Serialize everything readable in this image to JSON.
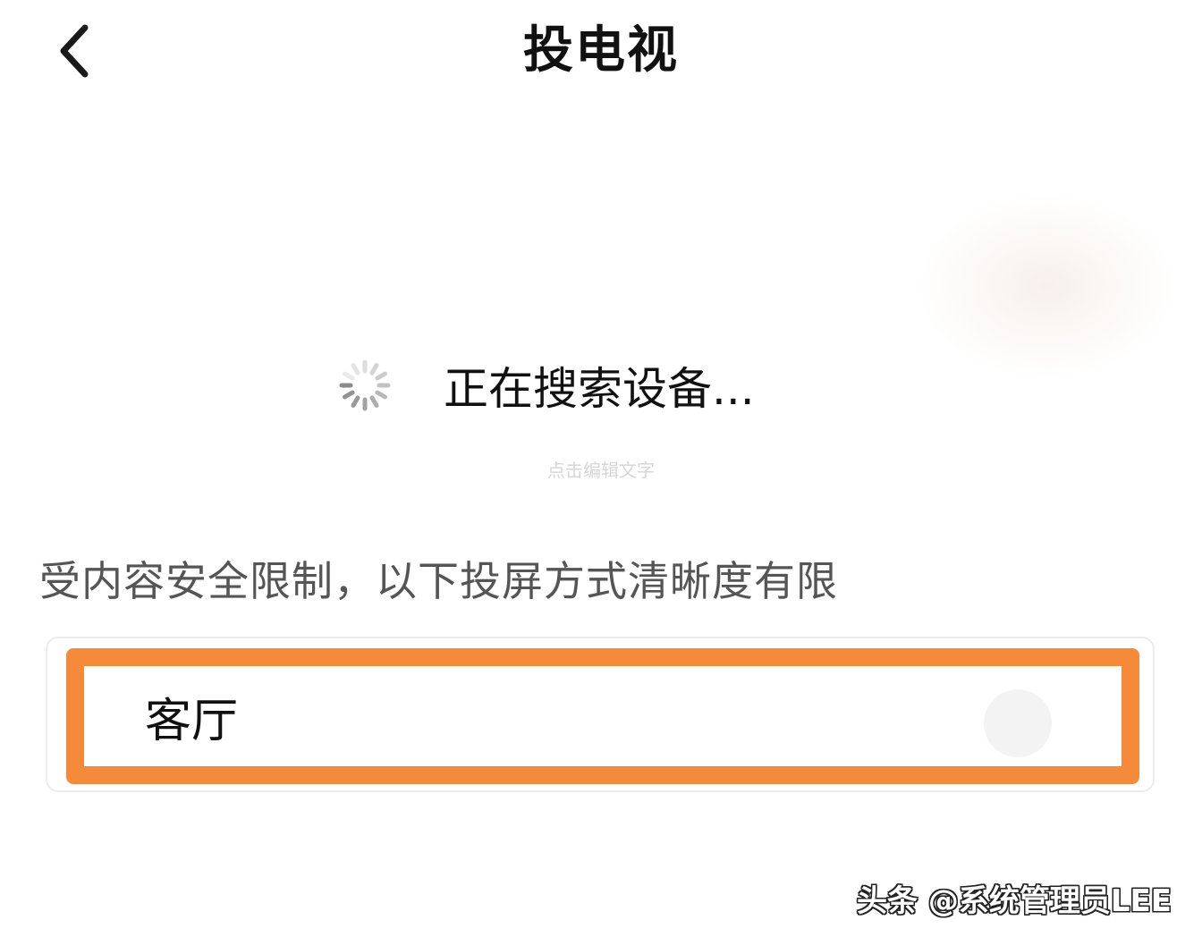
{
  "header": {
    "title": "投电视",
    "back_icon": "chevron-left-icon"
  },
  "search": {
    "status_text": "正在搜索设备...",
    "spinner_icon": "loading-spinner-icon",
    "edit_hint": "点击编辑文字"
  },
  "notice": {
    "text": "受内容安全限制，以下投屏方式清晰度有限"
  },
  "devices": [
    {
      "name": "客厅",
      "selected": false
    }
  ],
  "colors": {
    "highlight": "#f58a3a",
    "title_text": "#111111",
    "notice_text": "#555555"
  },
  "watermark": {
    "text": "头条 @系统管理员LEE"
  }
}
